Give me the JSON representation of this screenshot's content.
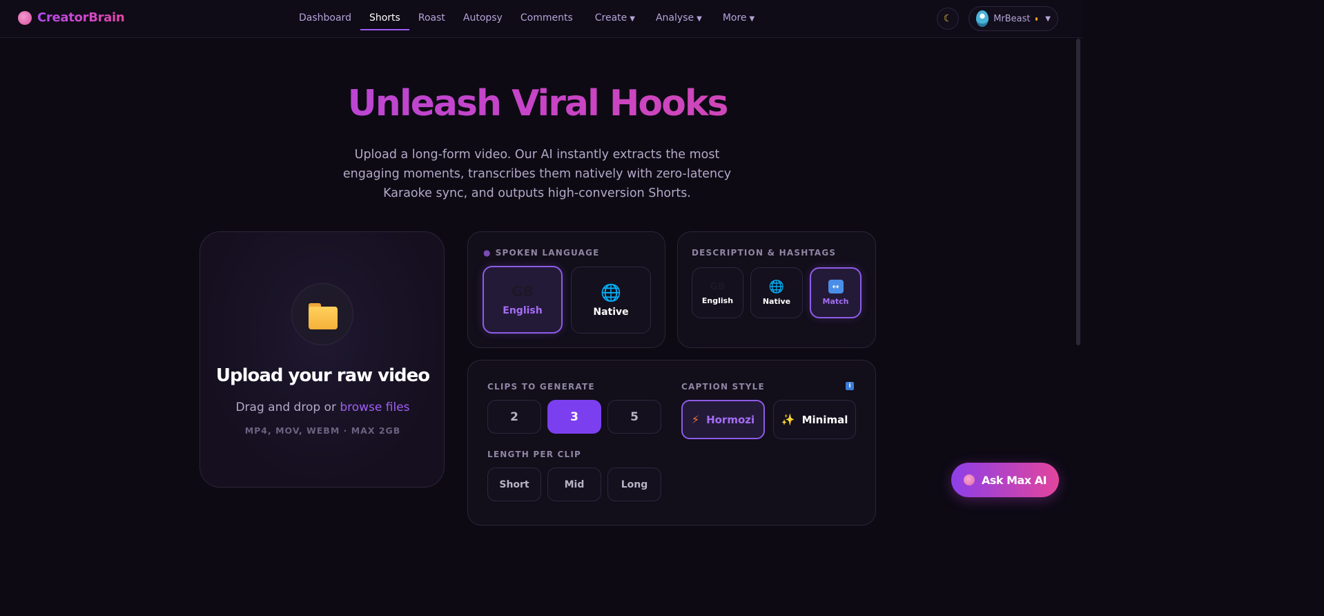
{
  "brand": {
    "name": "CreatorBrain"
  },
  "nav": {
    "links": [
      {
        "label": "Dashboard"
      },
      {
        "label": "Shorts"
      },
      {
        "label": "Roast"
      },
      {
        "label": "Autopsy"
      },
      {
        "label": "Comments"
      },
      {
        "label": "Create"
      },
      {
        "label": "Analyse"
      },
      {
        "label": "More"
      }
    ],
    "active": "Shorts",
    "caret": "▼"
  },
  "user": {
    "name": "MrBeast",
    "theme_icon": "moon-icon",
    "caret": "▼"
  },
  "hero": {
    "title": "Unleash Viral Hooks",
    "subtitle": "Upload a long-form video. Our AI instantly extracts the most engaging moments, transcribes them natively with zero-latency Karaoke sync, and outputs high-conversion Shorts."
  },
  "upload": {
    "title": "Upload your raw video",
    "drag_text": "Drag and drop or ",
    "browse_link": "browse files",
    "formats": "MP4, MOV, WEBM · MAX 2GB"
  },
  "spoken_language": {
    "label": "SPOKEN LANGUAGE",
    "options": [
      {
        "icon": "GB",
        "label": "English",
        "selected": true
      },
      {
        "icon": "globe-icon",
        "label": "Native",
        "selected": false
      }
    ]
  },
  "description_hashtags": {
    "label": "DESCRIPTION & HASHTAGS",
    "options": [
      {
        "icon": "GB",
        "label": "English",
        "selected": false
      },
      {
        "icon": "globe-icon",
        "label": "Native",
        "selected": false
      },
      {
        "icon": "left-right-arrow-icon",
        "label": "Match",
        "selected": true
      }
    ]
  },
  "clips": {
    "label": "CLIPS TO GENERATE",
    "options": [
      "2",
      "3",
      "5"
    ],
    "selected": "3"
  },
  "caption_style": {
    "label": "CAPTION STYLE",
    "info_icon": "i",
    "options": [
      {
        "icon": "lightning-icon",
        "label": "Hormozi",
        "selected": true
      },
      {
        "icon": "sparkles-icon",
        "label": "Minimal",
        "selected": false
      }
    ]
  },
  "length": {
    "label": "LENGTH PER CLIP",
    "options": [
      "Short",
      "Mid",
      "Long"
    ]
  },
  "ask": {
    "label": "Ask Max AI"
  },
  "colors": {
    "accent": "#7c3ff0",
    "brand_gradient_start": "#a64ae8",
    "brand_gradient_end": "#e04aa0",
    "background": "#0d0a14"
  }
}
